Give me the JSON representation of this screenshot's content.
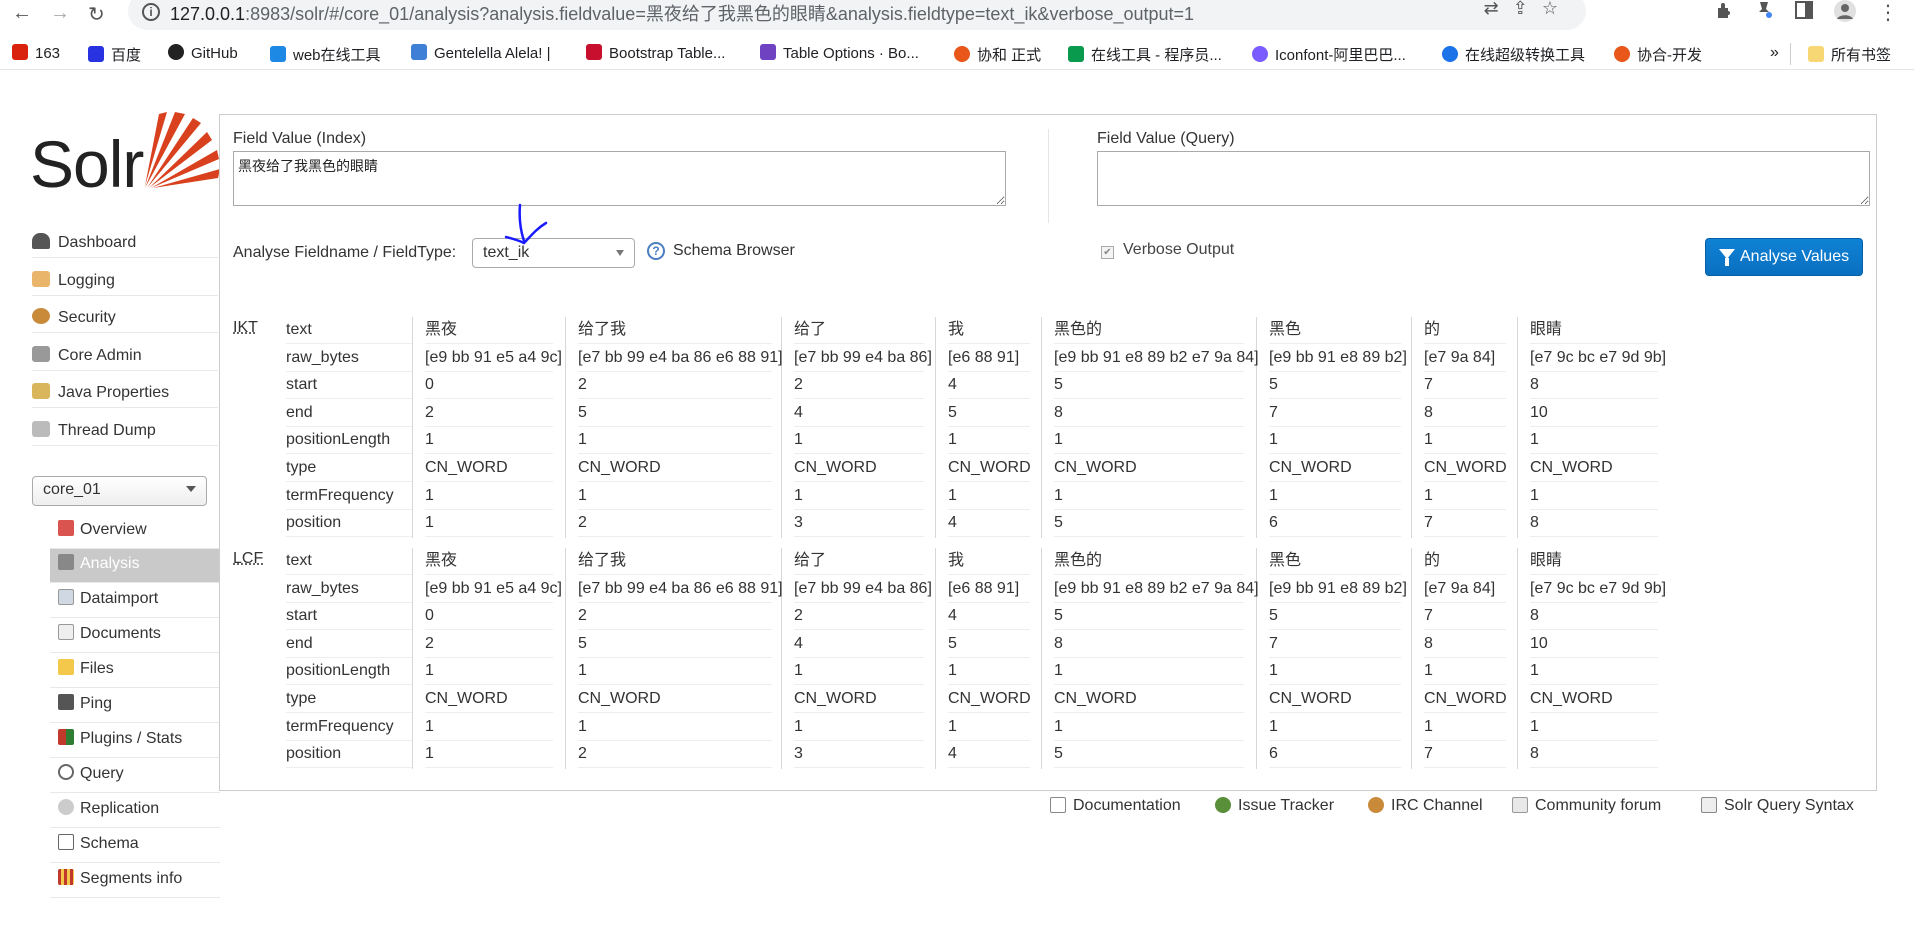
{
  "browser": {
    "url_host": "127.0.0.1",
    "url_rest": ":8983/solr/#/core_01/analysis?analysis.fieldvalue=黑夜给了我黑色的眼睛&analysis.fieldtype=text_ik&verbose_output=1",
    "bookmarks": [
      {
        "label": "163",
        "icon": "163-icon",
        "color": "#d9230f"
      },
      {
        "label": "百度",
        "icon": "baidu-icon",
        "color": "#2932e1"
      },
      {
        "label": "GitHub",
        "icon": "github-icon",
        "color": "#222222"
      },
      {
        "label": "web在线工具",
        "icon": "web-tools-icon",
        "color": "#1e88e5"
      },
      {
        "label": "Gentelella Alela! |",
        "icon": "gentelella-icon",
        "color": "#3f7fd6"
      },
      {
        "label": "Bootstrap Table...",
        "icon": "bootstrap-table-icon",
        "color": "#c8102e"
      },
      {
        "label": "Table Options · Bo...",
        "icon": "bt-icon",
        "color": "#6f42c1"
      },
      {
        "label": "协和 正式",
        "icon": "xiehe-icon",
        "color": "#e8561a"
      },
      {
        "label": "在线工具 - 程序员...",
        "icon": "tools-icon",
        "color": "#0a9a4d"
      },
      {
        "label": "Iconfont-阿里巴巴...",
        "icon": "iconfont-icon",
        "color": "#7b5cff"
      },
      {
        "label": "在线超级转换工具",
        "icon": "convert-icon",
        "color": "#1a73e8"
      },
      {
        "label": "协合-开发",
        "icon": "xiehe-dev-icon",
        "color": "#e8561a"
      }
    ],
    "more_chevron": "»",
    "all_bookmarks": "所有书签"
  },
  "logo": {
    "text": "Solr"
  },
  "sidebar": {
    "items": [
      {
        "label": "Dashboard",
        "icon": "dashboard-icon"
      },
      {
        "label": "Logging",
        "icon": "logging-icon"
      },
      {
        "label": "Security",
        "icon": "security-icon"
      },
      {
        "label": "Core Admin",
        "icon": "core-admin-icon"
      },
      {
        "label": "Java Properties",
        "icon": "java-properties-icon"
      },
      {
        "label": "Thread Dump",
        "icon": "thread-dump-icon"
      }
    ],
    "core_selector": "core_01",
    "core_menu": [
      {
        "label": "Overview",
        "icon": "overview-icon"
      },
      {
        "label": "Analysis",
        "icon": "analysis-icon",
        "active": true
      },
      {
        "label": "Dataimport",
        "icon": "dataimport-icon"
      },
      {
        "label": "Documents",
        "icon": "documents-icon"
      },
      {
        "label": "Files",
        "icon": "files-icon"
      },
      {
        "label": "Ping",
        "icon": "ping-icon"
      },
      {
        "label": "Plugins / Stats",
        "icon": "plugins-icon"
      },
      {
        "label": "Query",
        "icon": "query-icon"
      },
      {
        "label": "Replication",
        "icon": "replication-icon"
      },
      {
        "label": "Schema",
        "icon": "schema-icon"
      },
      {
        "label": "Segments info",
        "icon": "segments-icon"
      }
    ]
  },
  "analysis": {
    "field_value_index_label": "Field Value (Index)",
    "field_value_index": "黑夜给了我黑色的眼睛",
    "field_value_query_label": "Field Value (Query)",
    "field_value_query": "",
    "fieldtype_label": "Analyse Fieldname / FieldType:",
    "fieldtype_value": "text_ik",
    "schema_browser": "Schema Browser",
    "verbose_label": "Verbose Output",
    "verbose_checked": true,
    "analyse_button": "Analyse Values"
  },
  "attributes": [
    "text",
    "raw_bytes",
    "start",
    "end",
    "positionLength",
    "type",
    "termFrequency",
    "position"
  ],
  "stages": [
    {
      "name": "IKT",
      "tokens": [
        [
          "黑夜",
          "[e9 bb 91 e5 a4 9c]",
          "0",
          "2",
          "1",
          "CN_WORD",
          "1",
          "1"
        ],
        [
          "给了我",
          "[e7 bb 99 e4 ba 86 e6 88 91]",
          "2",
          "5",
          "1",
          "CN_WORD",
          "1",
          "2"
        ],
        [
          "给了",
          "[e7 bb 99 e4 ba 86]",
          "2",
          "4",
          "1",
          "CN_WORD",
          "1",
          "3"
        ],
        [
          "我",
          "[e6 88 91]",
          "4",
          "5",
          "1",
          "CN_WORD",
          "1",
          "4"
        ],
        [
          "黑色的",
          "[e9 bb 91 e8 89 b2 e7 9a 84]",
          "5",
          "8",
          "1",
          "CN_WORD",
          "1",
          "5"
        ],
        [
          "黑色",
          "[e9 bb 91 e8 89 b2]",
          "5",
          "7",
          "1",
          "CN_WORD",
          "1",
          "6"
        ],
        [
          "的",
          "[e7 9a 84]",
          "7",
          "8",
          "1",
          "CN_WORD",
          "1",
          "7"
        ],
        [
          "眼睛",
          "[e7 9c bc e7 9d 9b]",
          "8",
          "10",
          "1",
          "CN_WORD",
          "1",
          "8"
        ]
      ]
    },
    {
      "name": "LCF",
      "tokens": [
        [
          "黑夜",
          "[e9 bb 91 e5 a4 9c]",
          "0",
          "2",
          "1",
          "CN_WORD",
          "1",
          "1"
        ],
        [
          "给了我",
          "[e7 bb 99 e4 ba 86 e6 88 91]",
          "2",
          "5",
          "1",
          "CN_WORD",
          "1",
          "2"
        ],
        [
          "给了",
          "[e7 bb 99 e4 ba 86]",
          "2",
          "4",
          "1",
          "CN_WORD",
          "1",
          "3"
        ],
        [
          "我",
          "[e6 88 91]",
          "4",
          "5",
          "1",
          "CN_WORD",
          "1",
          "4"
        ],
        [
          "黑色的",
          "[e9 bb 91 e8 89 b2 e7 9a 84]",
          "5",
          "8",
          "1",
          "CN_WORD",
          "1",
          "5"
        ],
        [
          "黑色",
          "[e9 bb 91 e8 89 b2]",
          "5",
          "7",
          "1",
          "CN_WORD",
          "1",
          "6"
        ],
        [
          "的",
          "[e7 9a 84]",
          "7",
          "8",
          "1",
          "CN_WORD",
          "1",
          "7"
        ],
        [
          "眼睛",
          "[e7 9c bc e7 9d 9b]",
          "8",
          "10",
          "1",
          "CN_WORD",
          "1",
          "8"
        ]
      ]
    }
  ],
  "footer": [
    {
      "label": "Documentation",
      "icon": "documentation-icon"
    },
    {
      "label": "Issue Tracker",
      "icon": "bug-icon"
    },
    {
      "label": "IRC Channel",
      "icon": "irc-icon"
    },
    {
      "label": "Community forum",
      "icon": "mail-icon"
    },
    {
      "label": "Solr Query Syntax",
      "icon": "query-syntax-icon"
    }
  ]
}
